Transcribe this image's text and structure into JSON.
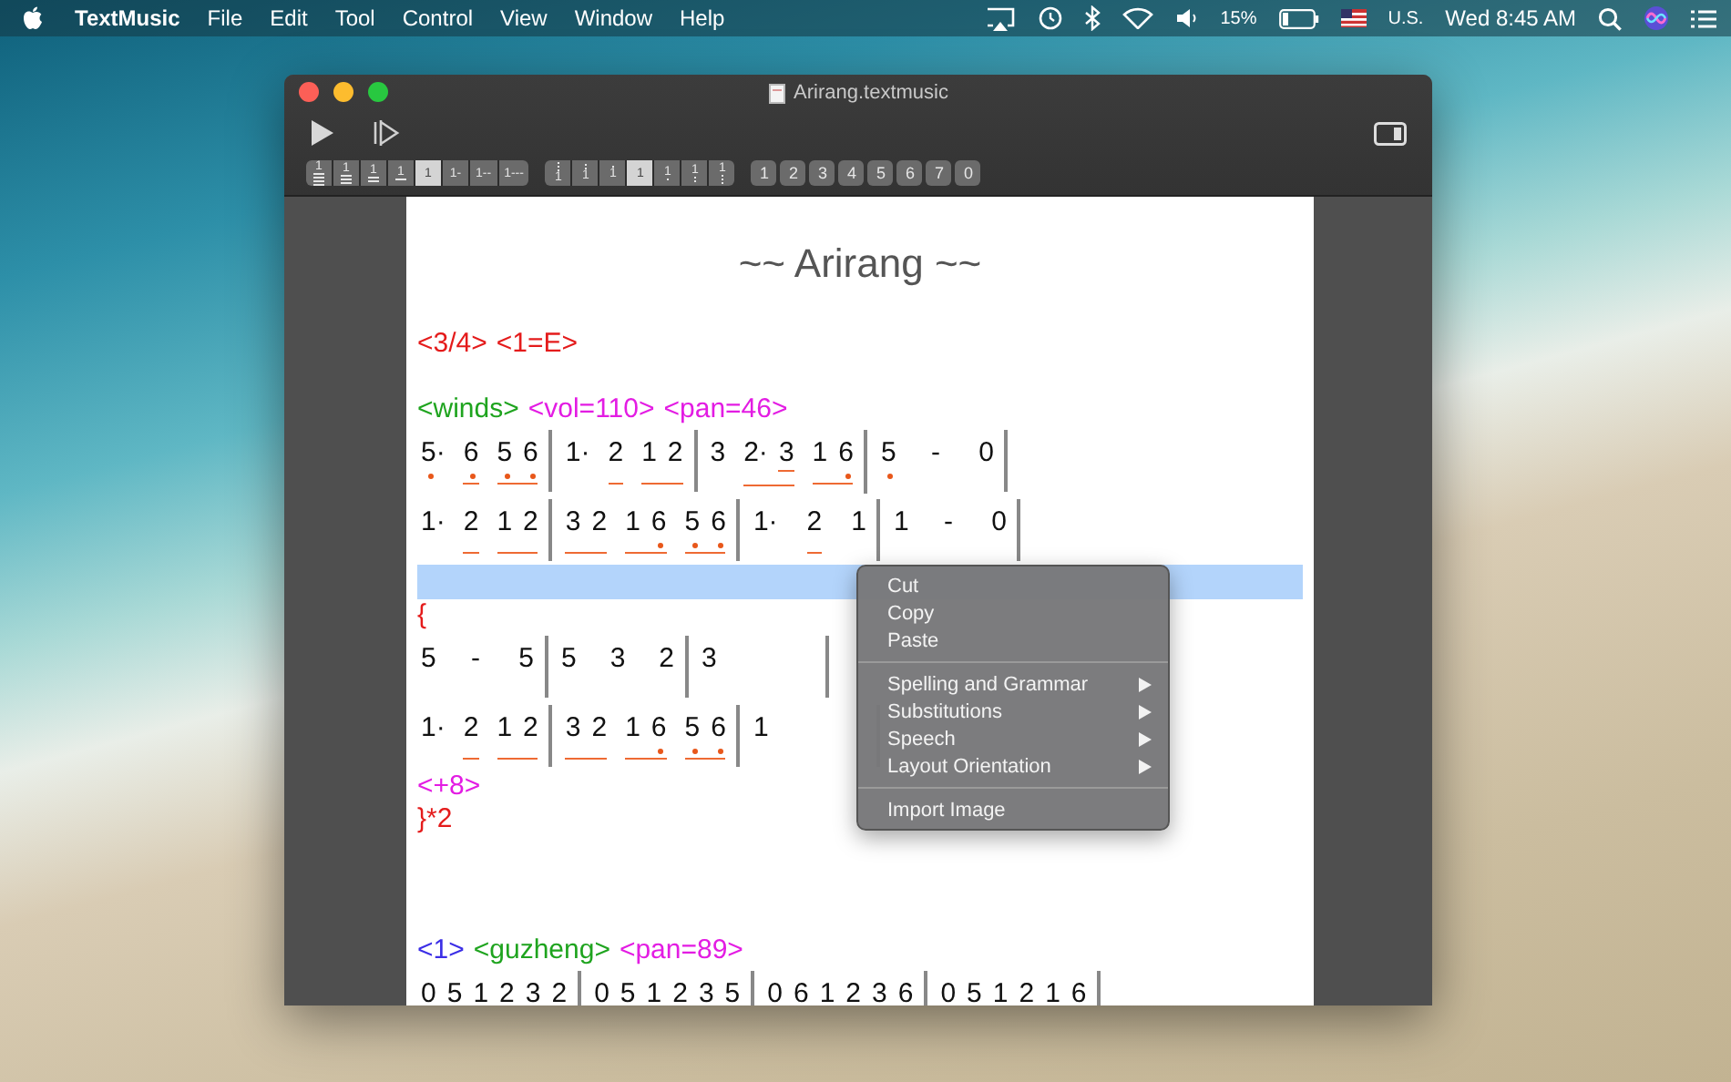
{
  "menubar": {
    "app": "TextMusic",
    "menus": [
      "File",
      "Edit",
      "Tool",
      "Control",
      "View",
      "Window",
      "Help"
    ],
    "battery": "15%",
    "input_source": "U.S.",
    "clock": "Wed 8:45 AM"
  },
  "window": {
    "title": "Arirang.textmusic"
  },
  "toolbar": {
    "segments": [
      {
        "kind": "joined",
        "buttons": [
          {
            "text": "1",
            "kind": "under4",
            "selected": false
          },
          {
            "text": "1",
            "kind": "under3",
            "selected": false
          },
          {
            "text": "1",
            "kind": "under2",
            "selected": false
          },
          {
            "text": "1",
            "kind": "under1",
            "selected": false
          },
          {
            "text": "1",
            "kind": "plain",
            "selected": true
          },
          {
            "text": "1-",
            "kind": "plain",
            "selected": false
          },
          {
            "text": "1--",
            "kind": "plain",
            "selected": false
          },
          {
            "text": "1---",
            "kind": "plain",
            "selected": false
          }
        ]
      },
      {
        "kind": "joined",
        "buttons": [
          {
            "text": "1",
            "kind": "above3",
            "selected": false
          },
          {
            "text": "1",
            "kind": "above2",
            "selected": false
          },
          {
            "text": "1",
            "kind": "above1",
            "selected": false
          },
          {
            "text": "1",
            "kind": "plain",
            "selected": true
          },
          {
            "text": "1",
            "kind": "below1",
            "selected": false
          },
          {
            "text": "1",
            "kind": "below2",
            "selected": false
          },
          {
            "text": "1",
            "kind": "below3",
            "selected": false
          }
        ]
      },
      {
        "kind": "separate",
        "buttons": [
          {
            "text": "1",
            "kind": "plain",
            "selected": false
          },
          {
            "text": "2",
            "kind": "plain",
            "selected": false
          },
          {
            "text": "3",
            "kind": "plain",
            "selected": false
          },
          {
            "text": "4",
            "kind": "plain",
            "selected": false
          },
          {
            "text": "5",
            "kind": "plain",
            "selected": false
          },
          {
            "text": "6",
            "kind": "plain",
            "selected": false
          },
          {
            "text": "7",
            "kind": "plain",
            "selected": false
          },
          {
            "text": "0",
            "kind": "plain",
            "selected": false
          }
        ]
      }
    ]
  },
  "score": [
    {
      "kind": "title",
      "text": "~~ Arirang ~~"
    },
    {
      "kind": "blank"
    },
    {
      "kind": "tags",
      "tokens": [
        {
          "text": "<3/4>",
          "color": "#e41b1b"
        },
        {
          "text": "<1=E>",
          "color": "#e41b1b"
        }
      ]
    },
    {
      "kind": "blank"
    },
    {
      "kind": "tags",
      "tokens": [
        {
          "text": "<winds>",
          "color": "#1fa41f"
        },
        {
          "text": "<vol=110>",
          "color": "#e31ce3"
        },
        {
          "text": "<pan=46>",
          "color": "#e31ce3"
        }
      ]
    },
    {
      "kind": "staff",
      "measures": [
        {
          "groups": [
            {
              "beamed": false,
              "notes": [
                {
                  "text": "5·",
                  "low": true,
                  "double": false
                }
              ]
            },
            {
              "beamed": true,
              "notes": [
                {
                  "text": "6",
                  "low": true,
                  "double": false
                }
              ]
            },
            {
              "beamed": true,
              "notes": [
                {
                  "text": "5",
                  "low": true,
                  "double": false
                },
                {
                  "text": "6",
                  "low": true,
                  "double": false
                }
              ]
            }
          ]
        },
        {
          "groups": [
            {
              "beamed": false,
              "notes": [
                {
                  "text": "1·",
                  "low": false,
                  "double": false
                }
              ]
            },
            {
              "beamed": true,
              "notes": [
                {
                  "text": "2",
                  "low": false,
                  "double": false
                }
              ]
            },
            {
              "beamed": true,
              "notes": [
                {
                  "text": "1",
                  "low": false,
                  "double": false
                },
                {
                  "text": "2",
                  "low": false,
                  "double": false
                }
              ]
            }
          ]
        },
        {
          "groups": [
            {
              "beamed": false,
              "notes": [
                {
                  "text": "3",
                  "low": false,
                  "double": false
                }
              ]
            },
            {
              "beamed": true,
              "notes": [
                {
                  "text": "2·",
                  "low": false,
                  "double": false
                },
                {
                  "text": "3",
                  "low": false,
                  "double": true
                }
              ]
            },
            {
              "beamed": true,
              "notes": [
                {
                  "text": "1",
                  "low": false,
                  "double": false
                },
                {
                  "text": "6",
                  "low": true,
                  "double": false
                }
              ]
            }
          ]
        },
        {
          "groups": [
            {
              "beamed": false,
              "notes": [
                {
                  "text": "5",
                  "low": true,
                  "double": false
                }
              ]
            },
            {
              "beamed": false,
              "notes": [
                {
                  "text": "-",
                  "low": false,
                  "double": false
                }
              ]
            },
            {
              "beamed": false,
              "notes": [
                {
                  "text": "0",
                  "low": false,
                  "double": false
                }
              ]
            }
          ]
        }
      ]
    },
    {
      "kind": "staff",
      "measures": [
        {
          "groups": [
            {
              "beamed": false,
              "notes": [
                {
                  "text": "1·",
                  "low": false,
                  "double": false
                }
              ]
            },
            {
              "beamed": true,
              "notes": [
                {
                  "text": "2",
                  "low": false,
                  "double": false
                }
              ]
            },
            {
              "beamed": true,
              "notes": [
                {
                  "text": "1",
                  "low": false,
                  "double": false
                },
                {
                  "text": "2",
                  "low": false,
                  "double": false
                }
              ]
            }
          ]
        },
        {
          "groups": [
            {
              "beamed": true,
              "notes": [
                {
                  "text": "3",
                  "low": false,
                  "double": false
                },
                {
                  "text": "2",
                  "low": false,
                  "double": false
                }
              ]
            },
            {
              "beamed": true,
              "notes": [
                {
                  "text": "1",
                  "low": false,
                  "double": false
                },
                {
                  "text": "6",
                  "low": true,
                  "double": false
                }
              ]
            },
            {
              "beamed": true,
              "notes": [
                {
                  "text": "5",
                  "low": true,
                  "double": false
                },
                {
                  "text": "6",
                  "low": true,
                  "double": false
                }
              ]
            }
          ]
        },
        {
          "groups": [
            {
              "beamed": false,
              "notes": [
                {
                  "text": "1·",
                  "low": false,
                  "double": false
                }
              ]
            },
            {
              "beamed": true,
              "notes": [
                {
                  "text": "2",
                  "low": false,
                  "double": false
                }
              ]
            },
            {
              "beamed": false,
              "notes": [
                {
                  "text": "1",
                  "low": false,
                  "double": false
                }
              ]
            }
          ]
        },
        {
          "groups": [
            {
              "beamed": false,
              "notes": [
                {
                  "text": "1",
                  "low": false,
                  "double": false
                }
              ]
            },
            {
              "beamed": false,
              "notes": [
                {
                  "text": "-",
                  "low": false,
                  "double": false
                }
              ]
            },
            {
              "beamed": false,
              "notes": [
                {
                  "text": "0",
                  "low": false,
                  "double": false
                }
              ]
            }
          ]
        }
      ]
    },
    {
      "kind": "selection"
    },
    {
      "kind": "tags",
      "tokens": [
        {
          "text": "{",
          "color": "#e41b1b"
        }
      ]
    },
    {
      "kind": "staff",
      "measures": [
        {
          "groups": [
            {
              "beamed": false,
              "notes": [
                {
                  "text": "5",
                  "low": false,
                  "double": false
                }
              ]
            },
            {
              "beamed": false,
              "notes": [
                {
                  "text": "-",
                  "low": false,
                  "double": false
                }
              ]
            },
            {
              "beamed": false,
              "notes": [
                {
                  "text": "5",
                  "low": false,
                  "double": false
                }
              ]
            }
          ]
        },
        {
          "groups": [
            {
              "beamed": false,
              "notes": [
                {
                  "text": "5",
                  "low": false,
                  "double": false
                }
              ]
            },
            {
              "beamed": false,
              "notes": [
                {
                  "text": "3",
                  "low": false,
                  "double": false
                }
              ]
            },
            {
              "beamed": false,
              "notes": [
                {
                  "text": "2",
                  "low": false,
                  "double": false
                }
              ]
            }
          ]
        },
        {
          "groups": [
            {
              "beamed": false,
              "notes": [
                {
                  "text": "3",
                  "low": false,
                  "double": false
                }
              ]
            }
          ]
        }
      ]
    },
    {
      "kind": "staff",
      "measures": [
        {
          "groups": [
            {
              "beamed": false,
              "notes": [
                {
                  "text": "1·",
                  "low": false,
                  "double": false
                }
              ]
            },
            {
              "beamed": true,
              "notes": [
                {
                  "text": "2",
                  "low": false,
                  "double": false
                }
              ]
            },
            {
              "beamed": true,
              "notes": [
                {
                  "text": "1",
                  "low": false,
                  "double": false
                },
                {
                  "text": "2",
                  "low": false,
                  "double": false
                }
              ]
            }
          ]
        },
        {
          "groups": [
            {
              "beamed": true,
              "notes": [
                {
                  "text": "3",
                  "low": false,
                  "double": false
                },
                {
                  "text": "2",
                  "low": false,
                  "double": false
                }
              ]
            },
            {
              "beamed": true,
              "notes": [
                {
                  "text": "1",
                  "low": false,
                  "double": false
                },
                {
                  "text": "6",
                  "low": true,
                  "double": false
                }
              ]
            },
            {
              "beamed": true,
              "notes": [
                {
                  "text": "5",
                  "low": true,
                  "double": false
                },
                {
                  "text": "6",
                  "low": true,
                  "double": false
                }
              ]
            }
          ]
        },
        {
          "groups": [
            {
              "beamed": false,
              "notes": [
                {
                  "text": "1",
                  "low": false,
                  "double": false
                }
              ]
            }
          ]
        }
      ]
    },
    {
      "kind": "tags",
      "tokens": [
        {
          "text": "<+8>",
          "color": "#e31ce3"
        }
      ]
    },
    {
      "kind": "tags",
      "tokens": [
        {
          "text": "}*2",
          "color": "#e41b1b"
        }
      ]
    },
    {
      "kind": "blank"
    },
    {
      "kind": "blank"
    },
    {
      "kind": "blank"
    },
    {
      "kind": "tags",
      "tokens": [
        {
          "text": "<1>",
          "color": "#3b2ee6"
        },
        {
          "text": "<guzheng>",
          "color": "#1fa41f"
        },
        {
          "text": "<pan=89>",
          "color": "#e31ce3"
        }
      ]
    },
    {
      "kind": "staff",
      "measures": [
        {
          "groups": [
            {
              "beamed": false,
              "notes": [
                {
                  "text": "0",
                  "low": false,
                  "double": false
                },
                {
                  "text": "5",
                  "low": false,
                  "double": false
                },
                {
                  "text": "1",
                  "low": false,
                  "double": false
                },
                {
                  "text": "2",
                  "low": false,
                  "double": false
                },
                {
                  "text": "3",
                  "low": false,
                  "double": false
                },
                {
                  "text": "2",
                  "low": false,
                  "double": false
                }
              ]
            }
          ]
        },
        {
          "groups": [
            {
              "beamed": false,
              "notes": [
                {
                  "text": "0",
                  "low": false,
                  "double": false
                },
                {
                  "text": "5",
                  "low": false,
                  "double": false
                },
                {
                  "text": "1",
                  "low": false,
                  "double": false
                },
                {
                  "text": "2",
                  "low": false,
                  "double": false
                },
                {
                  "text": "3",
                  "low": false,
                  "double": false
                },
                {
                  "text": "5",
                  "low": false,
                  "double": false
                }
              ]
            }
          ]
        },
        {
          "groups": [
            {
              "beamed": false,
              "notes": [
                {
                  "text": "0",
                  "low": false,
                  "double": false
                },
                {
                  "text": "6",
                  "low": false,
                  "double": false
                },
                {
                  "text": "1",
                  "low": false,
                  "double": false
                },
                {
                  "text": "2",
                  "low": false,
                  "double": false
                },
                {
                  "text": "3",
                  "low": false,
                  "double": false
                },
                {
                  "text": "6",
                  "low": false,
                  "double": false
                }
              ]
            }
          ]
        },
        {
          "groups": [
            {
              "beamed": false,
              "notes": [
                {
                  "text": "0",
                  "low": false,
                  "double": false
                },
                {
                  "text": "5",
                  "low": false,
                  "double": false
                },
                {
                  "text": "1",
                  "low": false,
                  "double": false
                },
                {
                  "text": "2",
                  "low": false,
                  "double": false
                },
                {
                  "text": "1",
                  "low": false,
                  "double": false
                },
                {
                  "text": "6",
                  "low": false,
                  "double": false
                }
              ]
            }
          ]
        }
      ]
    }
  ],
  "context_menu": {
    "items": [
      {
        "kind": "item",
        "label": "Cut"
      },
      {
        "kind": "item",
        "label": "Copy"
      },
      {
        "kind": "item",
        "label": "Paste"
      },
      {
        "kind": "separator"
      },
      {
        "kind": "submenu",
        "label": "Spelling and Grammar"
      },
      {
        "kind": "submenu",
        "label": "Substitutions"
      },
      {
        "kind": "submenu",
        "label": "Speech"
      },
      {
        "kind": "submenu",
        "label": "Layout Orientation"
      },
      {
        "kind": "separator"
      },
      {
        "kind": "item",
        "label": "Import Image"
      }
    ]
  }
}
